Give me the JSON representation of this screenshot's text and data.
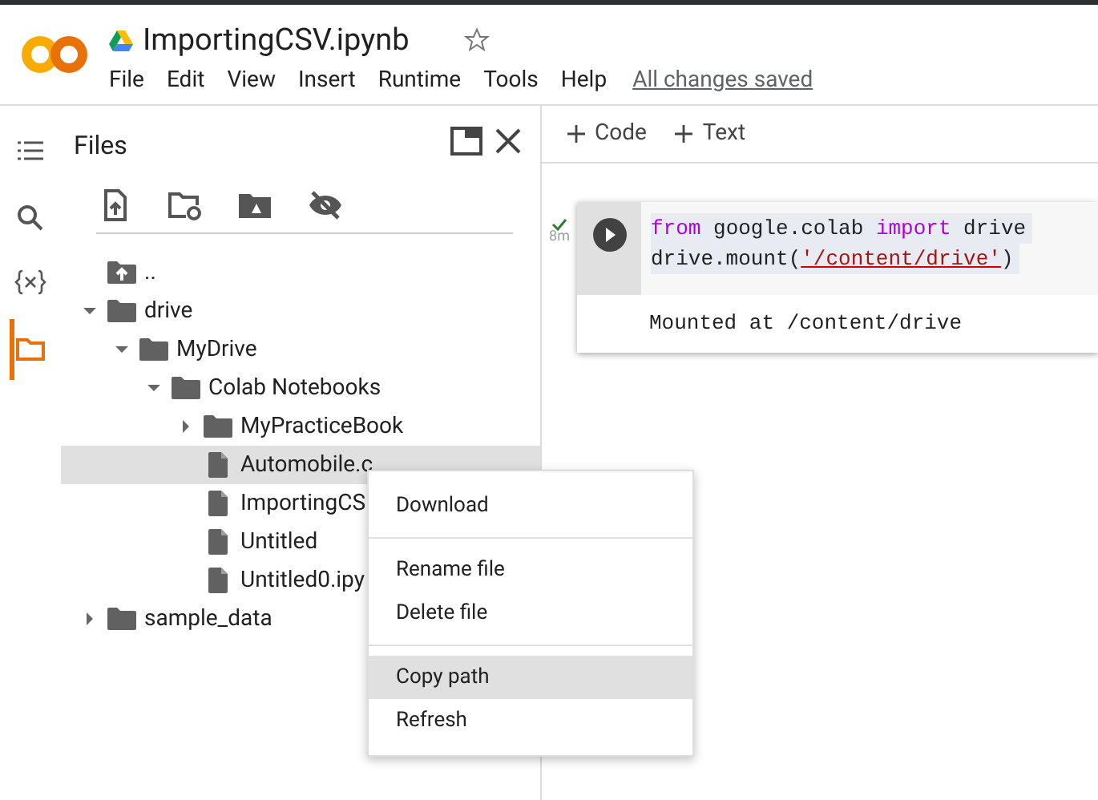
{
  "notebook": {
    "title": "ImportingCSV.ipynb",
    "menu": [
      "File",
      "Edit",
      "View",
      "Insert",
      "Runtime",
      "Tools",
      "Help"
    ],
    "save_status": "All changes saved"
  },
  "side_rail": [
    {
      "kind": "toc",
      "selected": false
    },
    {
      "kind": "search",
      "selected": false
    },
    {
      "kind": "variables",
      "selected": false
    },
    {
      "kind": "files",
      "selected": true
    }
  ],
  "files_panel": {
    "title": "Files",
    "tree": [
      {
        "kind": "parent",
        "name": ".."
      },
      {
        "kind": "folder",
        "name": "drive",
        "expanded": true,
        "selected": false,
        "children": [
          {
            "kind": "folder",
            "name": "MyDrive",
            "expanded": true,
            "selected": false,
            "children": [
              {
                "kind": "folder",
                "name": "Colab Notebooks",
                "expanded": true,
                "selected": false,
                "children": [
                  {
                    "kind": "folder",
                    "name": "MyPracticeBook",
                    "expanded": false,
                    "selected": false
                  },
                  {
                    "kind": "file",
                    "name": "Automobile.c",
                    "selected": true
                  },
                  {
                    "kind": "file",
                    "name": "ImportingCS",
                    "selected": false
                  },
                  {
                    "kind": "file",
                    "name": "Untitled",
                    "selected": false
                  },
                  {
                    "kind": "file",
                    "name": "Untitled0.ipy",
                    "selected": false
                  }
                ]
              }
            ]
          }
        ]
      },
      {
        "kind": "folder",
        "name": "sample_data",
        "expanded": false,
        "selected": false
      }
    ]
  },
  "toolbar": [
    "Code",
    "Text"
  ],
  "cell": {
    "status": "8m",
    "code": [
      [
        {
          "t": "from",
          "kind": "keyword"
        },
        {
          "t": " google.colab ",
          "kind": "plain"
        },
        {
          "t": "import",
          "kind": "keyword"
        },
        {
          "t": " drive",
          "kind": "plain"
        }
      ],
      [
        {
          "t": "drive.mount(",
          "kind": "plain"
        },
        {
          "t": "'/content/drive'",
          "kind": "string"
        },
        {
          "t": ")",
          "kind": "plain"
        }
      ]
    ],
    "output": "Mounted at /content/drive"
  },
  "context_menu": [
    {
      "label": "Download",
      "selected": false,
      "divider_after": true
    },
    {
      "label": "Rename file",
      "selected": false,
      "divider_after": false
    },
    {
      "label": "Delete file",
      "selected": false,
      "divider_after": true
    },
    {
      "label": "Copy path",
      "selected": true,
      "divider_after": false
    },
    {
      "label": "Refresh",
      "selected": false,
      "divider_after": false
    }
  ]
}
